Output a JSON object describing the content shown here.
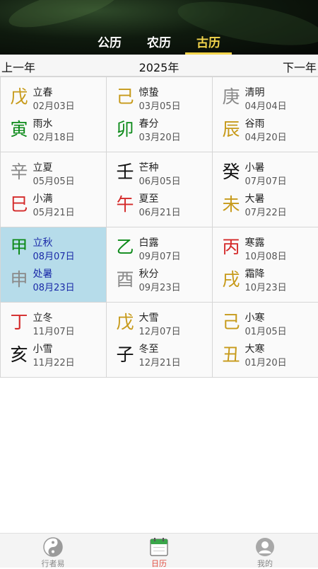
{
  "tabs": [
    {
      "label": "公历",
      "active": false
    },
    {
      "label": "农历",
      "active": false
    },
    {
      "label": "古历",
      "active": true
    }
  ],
  "yearbar": {
    "prev": "上一年",
    "year": "2025年",
    "next": "下一年"
  },
  "colors": {
    "yellow": "#c79a1a",
    "green": "#0d8a1a",
    "gray": "#8a8a8a",
    "red": "#d42a2a",
    "black": "#111111",
    "tab_active": "#f3d54c",
    "selected_bg": "#b6dcea",
    "nav_active": "#e24c40"
  },
  "cells": [
    {
      "gan": "戊",
      "gan_color": "yellow",
      "zhi": "寅",
      "zhi_color": "green",
      "term1": "立春",
      "date1": "02月03日",
      "term2": "雨水",
      "date2": "02月18日"
    },
    {
      "gan": "己",
      "gan_color": "yellow",
      "zhi": "卯",
      "zhi_color": "green",
      "term1": "惊蛰",
      "date1": "03月05日",
      "term2": "春分",
      "date2": "03月20日"
    },
    {
      "gan": "庚",
      "gan_color": "gray",
      "zhi": "辰",
      "zhi_color": "yellow",
      "term1": "清明",
      "date1": "04月04日",
      "term2": "谷雨",
      "date2": "04月20日"
    },
    {
      "gan": "辛",
      "gan_color": "gray",
      "zhi": "巳",
      "zhi_color": "red",
      "term1": "立夏",
      "date1": "05月05日",
      "term2": "小满",
      "date2": "05月21日"
    },
    {
      "gan": "壬",
      "gan_color": "black",
      "zhi": "午",
      "zhi_color": "red",
      "term1": "芒种",
      "date1": "06月05日",
      "term2": "夏至",
      "date2": "06月21日"
    },
    {
      "gan": "癸",
      "gan_color": "black",
      "zhi": "未",
      "zhi_color": "yellow",
      "term1": "小暑",
      "date1": "07月07日",
      "term2": "大暑",
      "date2": "07月22日"
    },
    {
      "gan": "甲",
      "gan_color": "green",
      "zhi": "申",
      "zhi_color": "gray",
      "term1": "立秋",
      "date1": "08月07日",
      "term2": "处暑",
      "date2": "08月23日",
      "selected": true
    },
    {
      "gan": "乙",
      "gan_color": "green",
      "zhi": "酉",
      "zhi_color": "gray",
      "term1": "白露",
      "date1": "09月07日",
      "term2": "秋分",
      "date2": "09月23日"
    },
    {
      "gan": "丙",
      "gan_color": "red",
      "zhi": "戌",
      "zhi_color": "yellow",
      "term1": "寒露",
      "date1": "10月08日",
      "term2": "霜降",
      "date2": "10月23日"
    },
    {
      "gan": "丁",
      "gan_color": "red",
      "zhi": "亥",
      "zhi_color": "black",
      "term1": "立冬",
      "date1": "11月07日",
      "term2": "小雪",
      "date2": "11月22日"
    },
    {
      "gan": "戊",
      "gan_color": "yellow",
      "zhi": "子",
      "zhi_color": "black",
      "term1": "大雪",
      "date1": "12月07日",
      "term2": "冬至",
      "date2": "12月21日"
    },
    {
      "gan": "己",
      "gan_color": "yellow",
      "zhi": "丑",
      "zhi_color": "yellow",
      "term1": "小寒",
      "date1": "01月05日",
      "term2": "大寒",
      "date2": "01月20日"
    }
  ],
  "bottom_nav": [
    {
      "label": "行者易",
      "icon": "yin-yang-icon",
      "active": false
    },
    {
      "label": "日历",
      "icon": "calendar-icon",
      "active": true
    },
    {
      "label": "我的",
      "icon": "user-icon",
      "active": false
    }
  ]
}
